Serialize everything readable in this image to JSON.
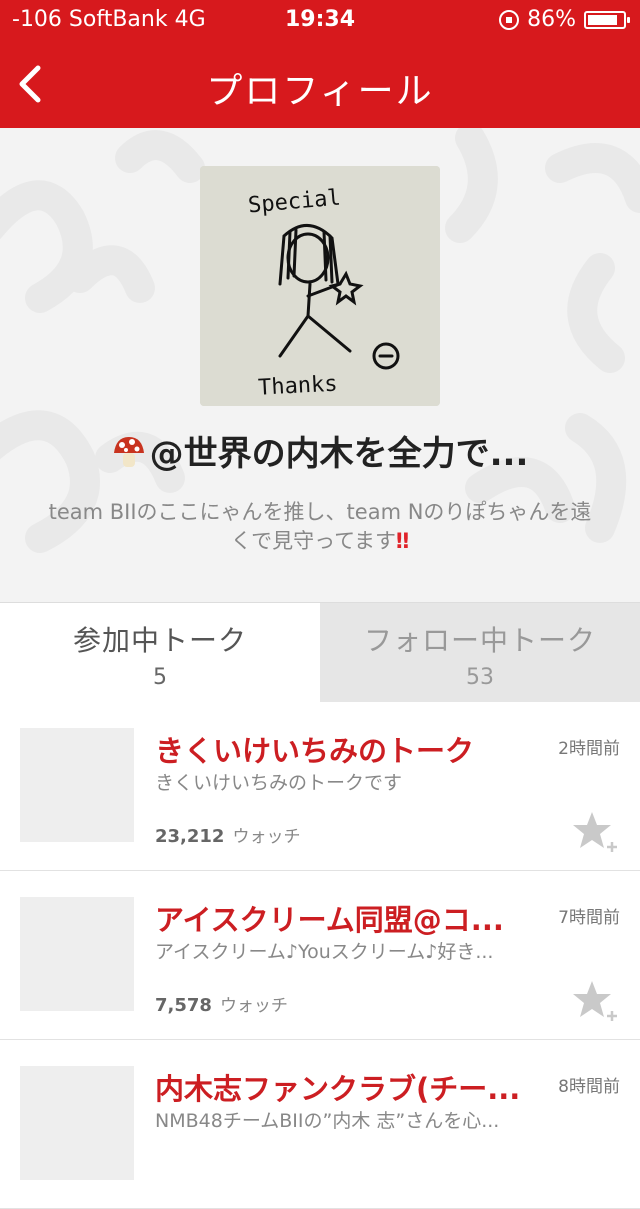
{
  "status_bar": {
    "carrier": "-106 SoftBank   4G",
    "time": "19:34",
    "battery": "86%",
    "battery_level": 0.86
  },
  "nav": {
    "title": "プロフィール",
    "back_icon": "chevron-left-icon"
  },
  "profile": {
    "name": "@世界の内木を全力で...",
    "name_icon": "mushroom-emoji-icon",
    "bio_text": "team BIIのここにゃんを推し、team Nのりぽちゃんを遠くで見守ってます",
    "bio_emphasis": "‼",
    "avatar": {
      "text_top": "Special",
      "text_bottom": "Thanks"
    }
  },
  "tabs": [
    {
      "label": "参加中トーク",
      "count": "5",
      "active": true
    },
    {
      "label": "フォロー中トーク",
      "count": "53",
      "active": false
    }
  ],
  "talks": [
    {
      "title": "きくいけいちみのトーク",
      "description": "きくいけいちみのトークです",
      "time": "2時間前",
      "watch_count": "23,212",
      "watch_label": "ウォッチ"
    },
    {
      "title": "アイスクリーム同盟@コ...",
      "description": "アイスクリーム♪Youスクリーム♪好き...",
      "time": "7時間前",
      "watch_count": "7,578",
      "watch_label": "ウォッチ"
    },
    {
      "title": "内木志ファンクラブ(チー...",
      "description": "NMB48チームBIIの”内木 志”さんを心...",
      "time": "8時間前",
      "watch_count": "",
      "watch_label": ""
    }
  ],
  "colors": {
    "brand_red": "#d7191d",
    "title_red": "#cc1e22",
    "profile_bg": "#f3f3f3"
  }
}
